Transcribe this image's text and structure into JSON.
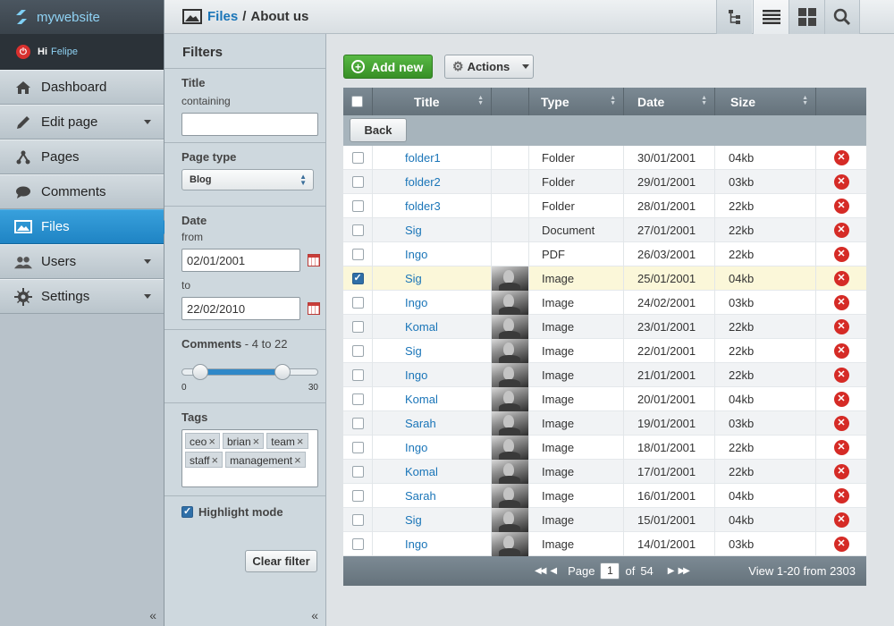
{
  "brand": {
    "name": "mywebsite"
  },
  "user": {
    "greeting": "Hi",
    "name": "Felipe"
  },
  "nav": [
    {
      "label": "Dashboard",
      "icon": "home-icon",
      "has_submenu": false
    },
    {
      "label": "Edit page",
      "icon": "pencil-icon",
      "has_submenu": true
    },
    {
      "label": "Pages",
      "icon": "sitemap-icon",
      "has_submenu": false
    },
    {
      "label": "Comments",
      "icon": "speech-bubble-icon",
      "has_submenu": false
    },
    {
      "label": "Files",
      "icon": "image-icon",
      "has_submenu": false,
      "active": true
    },
    {
      "label": "Users",
      "icon": "users-icon",
      "has_submenu": true
    },
    {
      "label": "Settings",
      "icon": "gear-icon",
      "has_submenu": true
    }
  ],
  "breadcrumb": {
    "parent": "Files",
    "separator": "/",
    "current": "About us"
  },
  "toolbar": [
    "tree-view-icon",
    "list-view-icon",
    "grid-view-icon",
    "search-icon"
  ],
  "filters": {
    "heading": "Filters",
    "title": {
      "label": "Title",
      "sublabel": "containing",
      "value": ""
    },
    "page_type": {
      "label": "Page type",
      "value": "Blog"
    },
    "date": {
      "label": "Date",
      "from_label": "from",
      "from": "02/01/2001",
      "to_label": "to",
      "to": "22/02/2010"
    },
    "comments": {
      "label": "Comments",
      "range_text": " - 4 to 22",
      "min": 0,
      "max": 30,
      "low": 4,
      "high": 22,
      "min_label": "0",
      "max_label": "30"
    },
    "tags": {
      "label": "Tags",
      "items": [
        "ceo",
        "brian",
        "team",
        "staff",
        "management"
      ]
    },
    "highlight": {
      "label": "Highlight mode",
      "checked": true
    },
    "clear_label": "Clear filter"
  },
  "buttons": {
    "add_new": "Add new",
    "actions": "Actions",
    "back": "Back"
  },
  "table": {
    "columns": [
      "Title",
      "Type",
      "Date",
      "Size"
    ],
    "rows": [
      {
        "title": "folder1",
        "type": "Folder",
        "date": "30/01/2001",
        "size": "04kb",
        "thumb": false,
        "checked": false
      },
      {
        "title": "folder2",
        "type": "Folder",
        "date": "29/01/2001",
        "size": "03kb",
        "thumb": false,
        "checked": false
      },
      {
        "title": "folder3",
        "type": "Folder",
        "date": "28/01/2001",
        "size": "22kb",
        "thumb": false,
        "checked": false
      },
      {
        "title": "Sig",
        "type": "Document",
        "date": "27/01/2001",
        "size": "22kb",
        "thumb": false,
        "checked": false
      },
      {
        "title": "Ingo",
        "type": "PDF",
        "date": "26/03/2001",
        "size": "22kb",
        "thumb": false,
        "checked": false
      },
      {
        "title": "Sig",
        "type": "Image",
        "date": "25/01/2001",
        "size": "04kb",
        "thumb": true,
        "checked": true
      },
      {
        "title": "Ingo",
        "type": "Image",
        "date": "24/02/2001",
        "size": "03kb",
        "thumb": true,
        "checked": false
      },
      {
        "title": "Komal",
        "type": "Image",
        "date": "23/01/2001",
        "size": "22kb",
        "thumb": true,
        "checked": false
      },
      {
        "title": "Sig",
        "type": "Image",
        "date": "22/01/2001",
        "size": "22kb",
        "thumb": true,
        "checked": false
      },
      {
        "title": "Ingo",
        "type": "Image",
        "date": "21/01/2001",
        "size": "22kb",
        "thumb": true,
        "checked": false
      },
      {
        "title": "Komal",
        "type": "Image",
        "date": "20/01/2001",
        "size": "04kb",
        "thumb": true,
        "checked": false
      },
      {
        "title": "Sarah",
        "type": "Image",
        "date": "19/01/2001",
        "size": "03kb",
        "thumb": true,
        "checked": false
      },
      {
        "title": "Ingo",
        "type": "Image",
        "date": "18/01/2001",
        "size": "22kb",
        "thumb": true,
        "checked": false
      },
      {
        "title": "Komal",
        "type": "Image",
        "date": "17/01/2001",
        "size": "22kb",
        "thumb": true,
        "checked": false
      },
      {
        "title": "Sarah",
        "type": "Image",
        "date": "16/01/2001",
        "size": "04kb",
        "thumb": true,
        "checked": false
      },
      {
        "title": "Sig",
        "type": "Image",
        "date": "15/01/2001",
        "size": "04kb",
        "thumb": true,
        "checked": false
      },
      {
        "title": "Ingo",
        "type": "Image",
        "date": "14/01/2001",
        "size": "03kb",
        "thumb": true,
        "checked": false
      }
    ]
  },
  "pagination": {
    "page_label": "Page",
    "current": "1",
    "of_label": "of",
    "total": "54",
    "view_info": "View 1-20 from 2303"
  },
  "colors": {
    "accent": "#1f84c4",
    "add_button": "#378f26",
    "delete": "#d52b26",
    "selected_row": "#fbf7d9"
  }
}
